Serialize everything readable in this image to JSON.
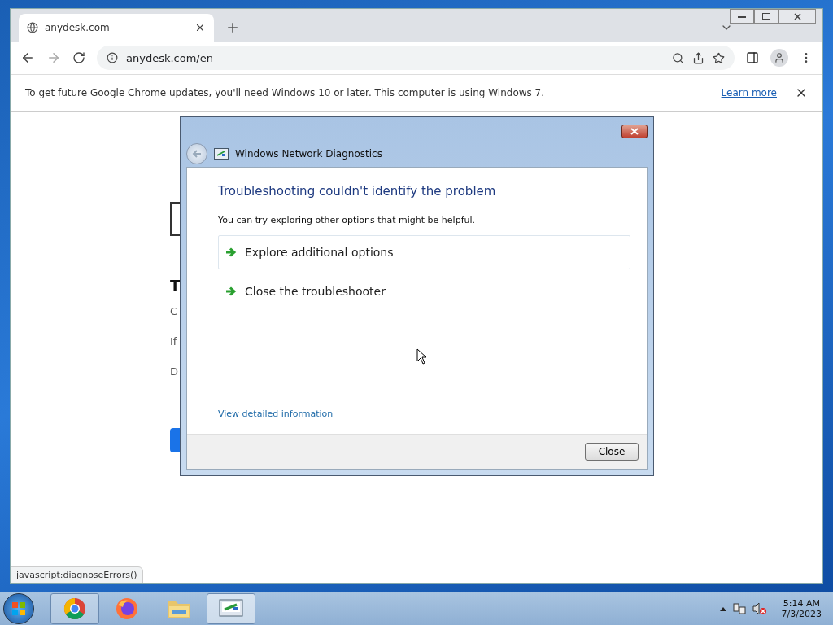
{
  "browser": {
    "tab": {
      "title": "anydesk.com"
    },
    "address": "anydesk.com/en",
    "infobar": {
      "message": "To get future Google Chrome updates, you'll need Windows 10 or later. This computer is using Windows 7.",
      "link": "Learn more"
    },
    "page_fragments": [
      {
        "kind": "box"
      },
      {
        "kind": "heading",
        "text": "T"
      },
      {
        "kind": "line",
        "text": "C"
      },
      {
        "kind": "line",
        "text": "If"
      },
      {
        "kind": "line",
        "text": "D"
      },
      {
        "kind": "button"
      }
    ],
    "status_url": "javascript:diagnoseErrors()"
  },
  "dialog": {
    "title": "Windows Network Diagnostics",
    "heading": "Troubleshooting couldn't identify the problem",
    "intro": "You can try exploring other options that might be helpful.",
    "options": [
      {
        "label": "Explore additional options",
        "selected": true
      },
      {
        "label": "Close the troubleshooter",
        "selected": false
      }
    ],
    "details_link": "View detailed information",
    "button": "Close"
  },
  "taskbar": {
    "apps": [
      {
        "kind": "chrome",
        "running": true,
        "selected": false
      },
      {
        "kind": "firefox",
        "running": false,
        "selected": false
      },
      {
        "kind": "explorer",
        "running": false,
        "selected": false
      },
      {
        "kind": "diagnostics",
        "running": true,
        "selected": true
      }
    ],
    "time": "5:14 AM",
    "date": "7/3/2023"
  }
}
